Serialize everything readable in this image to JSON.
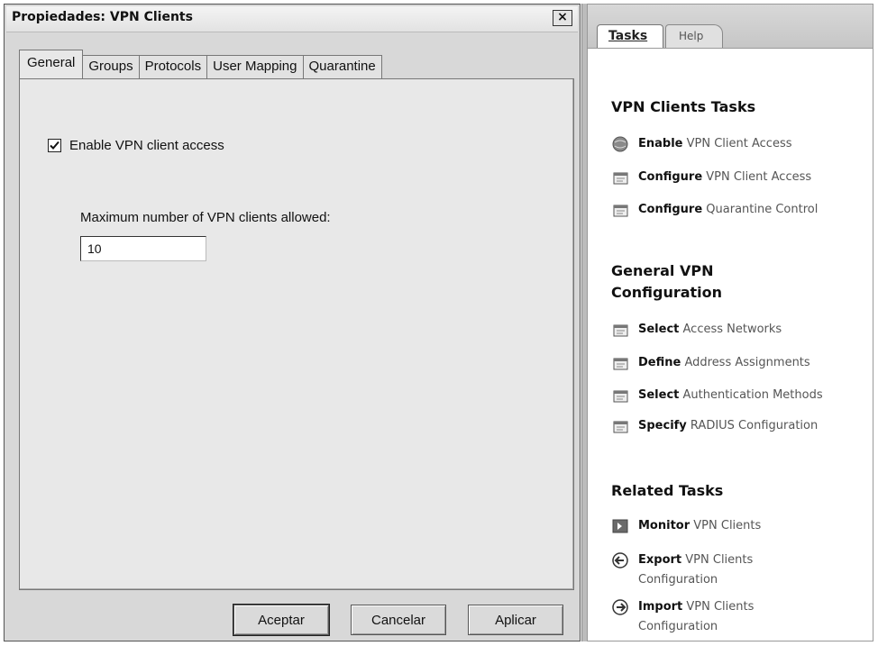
{
  "dialog": {
    "title": "Propiedades: VPN Clients",
    "close_label": "×",
    "tabs": [
      {
        "label": "General",
        "active": true
      },
      {
        "label": "Groups",
        "active": false
      },
      {
        "label": "Protocols",
        "active": false
      },
      {
        "label": "User Mapping",
        "active": false
      },
      {
        "label": "Quarantine",
        "active": false
      }
    ],
    "enable_checkbox": {
      "label": "Enable VPN client access",
      "checked": true
    },
    "max_clients": {
      "label": "Maximum number of VPN clients allowed:",
      "value": "10"
    },
    "buttons": {
      "ok": "Aceptar",
      "cancel": "Cancelar",
      "apply": "Aplicar"
    }
  },
  "taskpane": {
    "tabs": {
      "active": "Tasks",
      "inactive": "Help"
    },
    "sections": [
      {
        "title": "VPN Clients Tasks",
        "items": [
          {
            "verb": "Enable",
            "rest": " VPN Client Access",
            "icon": "enable-globe-icon"
          },
          {
            "verb": "Configure",
            "rest": " VPN Client Access",
            "icon": "properties-icon"
          },
          {
            "verb": "Configure",
            "rest": " Quarantine Control",
            "icon": "properties-icon"
          }
        ]
      },
      {
        "title_line1": "General VPN",
        "title_line2": "Configuration",
        "items": [
          {
            "verb": "Select",
            "rest": " Access Networks",
            "icon": "properties-icon"
          },
          {
            "verb": "Define",
            "rest": " Address Assignments",
            "icon": "properties-icon"
          },
          {
            "verb": "Select",
            "rest": " Authentication Methods",
            "icon": "properties-icon"
          },
          {
            "verb": "Specify",
            "rest": " RADIUS Configuration",
            "icon": "properties-icon"
          }
        ]
      },
      {
        "title": "Related Tasks",
        "items": [
          {
            "verb": "Monitor",
            "rest": " VPN Clients",
            "icon": "monitor-arrow-icon"
          },
          {
            "verb": "Export",
            "rest": " VPN Clients",
            "line2": "Configuration",
            "icon": "export-arrow-icon"
          },
          {
            "verb": "Import",
            "rest": " VPN Clients",
            "line2": "Configuration",
            "icon": "import-arrow-icon"
          }
        ]
      }
    ]
  }
}
